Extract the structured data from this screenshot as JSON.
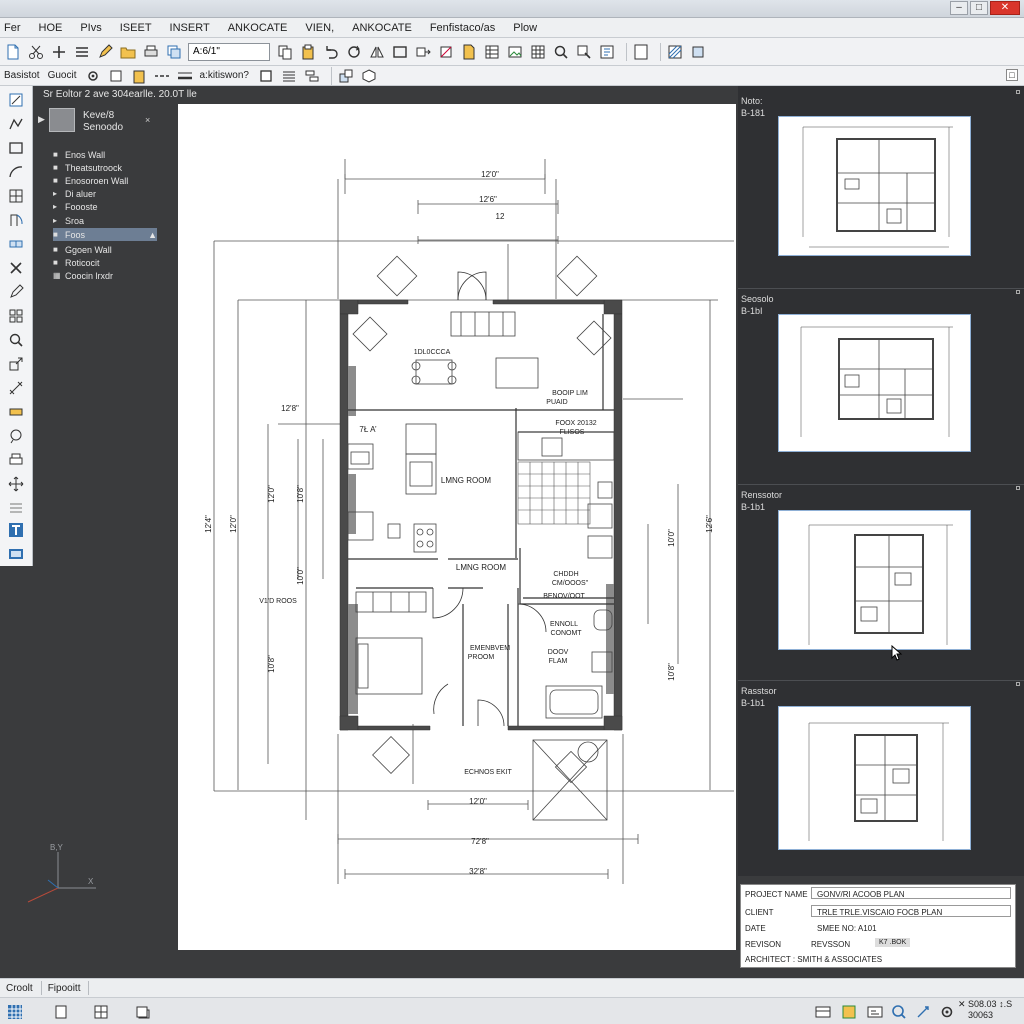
{
  "menu": [
    "Fer",
    "HOE",
    "PIvs",
    "ISEET",
    "INSERT",
    "ANKOCATE",
    "VIEN,",
    "ANKOCATE",
    "Fenfistaco/as",
    "Plow"
  ],
  "toolbar1": {
    "input_value": "A:6/1\""
  },
  "toolbar2": {
    "label_left": "Basistot",
    "label_2": "Guocit",
    "label_3": "a:kitiswon?"
  },
  "layer_panel": {
    "title": "Sr Eoltor 2  ave  304earlle.  20.0T lle",
    "layer_name": "Keve/8",
    "layer_sub": "Senoodo",
    "items": [
      "Enos Wall",
      "Theatsutroock",
      "Enosoroen Wall",
      "Di aluer",
      "Foooste",
      "Sroa",
      "Foos",
      "Ggoen Wall",
      "Roticocit",
      "Coocin lrxdr"
    ],
    "selected_index": 6
  },
  "drawing": {
    "dims": {
      "top_outer": "12'0\"",
      "top_inner": "12'6\"",
      "top_small": "12",
      "bottom_a": "12'0\"",
      "bottom_b": "72'8\"",
      "bottom_c": "32'8\""
    },
    "left_dims": [
      "12'8\"",
      "12'4\"",
      "12'0\"",
      "12'0\"",
      "10'8\"",
      "10'8\"",
      "10'0\"",
      "V1'D ROOS"
    ],
    "right_dims": [
      "10'0\"",
      "10'8\"",
      "12'6\""
    ],
    "rooms": {
      "top_left_label": "1DL0CCCA",
      "living_1": "LMNG ROOM",
      "living_2": "LMNG ROOM",
      "room_tr_1": "BOOIP LIM",
      "room_tr_2": "PUAID",
      "room_tr_3": "FOOX 20132",
      "room_tr_4": "FLISOS",
      "closet_1": "CHDDH",
      "closet_2": "CM/OOOS\"",
      "closet_3": "BENOV/OOT",
      "bath_1": "ENNOLL",
      "bath_2": "CONOMT",
      "bath_3": "DOOV",
      "bath_4": "FLAM",
      "bedroom_1": "EMENBVEM",
      "bedroom_2": "PROOM",
      "entry": "ECHNOS EKIT",
      "marker": "7Ł A’"
    }
  },
  "thumbnails": [
    {
      "head": "Noto:",
      "sub": "B-181"
    },
    {
      "head": "Seosolo",
      "sub": "B-1bI"
    },
    {
      "head": "Renssotor",
      "sub": "B-1b1"
    },
    {
      "head": "Rasstsor",
      "sub": "B-1b1"
    }
  ],
  "title_block": {
    "project_name_label": "PROJECT NAME",
    "project_name_value": "GONV/RI ACOOB PLAN",
    "client_label": "CLIENT",
    "client_value": "TRLE TRLE.VISCAIO FOCB PLAN",
    "date_label": "DATE",
    "date_value": "SMEE NO:  A101",
    "revision_label": "REVISON",
    "revision_value": "REVSSON",
    "revision_badge": "K7 .BOK",
    "architect": "ARCHITECT : SMITH & ASSOCIATES"
  },
  "status": {
    "left": "Croolt",
    "mid": "Fipooitt"
  },
  "coords": {
    "line1": "✕  S08.03 ↕.S",
    "line2": "30063"
  },
  "ucs": {
    "y": "B,Y",
    "x": "X"
  },
  "colors": {
    "sheet": "#ffffff",
    "chrome": "#eef0f2",
    "background": "#3a3b3d",
    "wall": "#4a4a4a",
    "selection": "#6d7e94"
  }
}
